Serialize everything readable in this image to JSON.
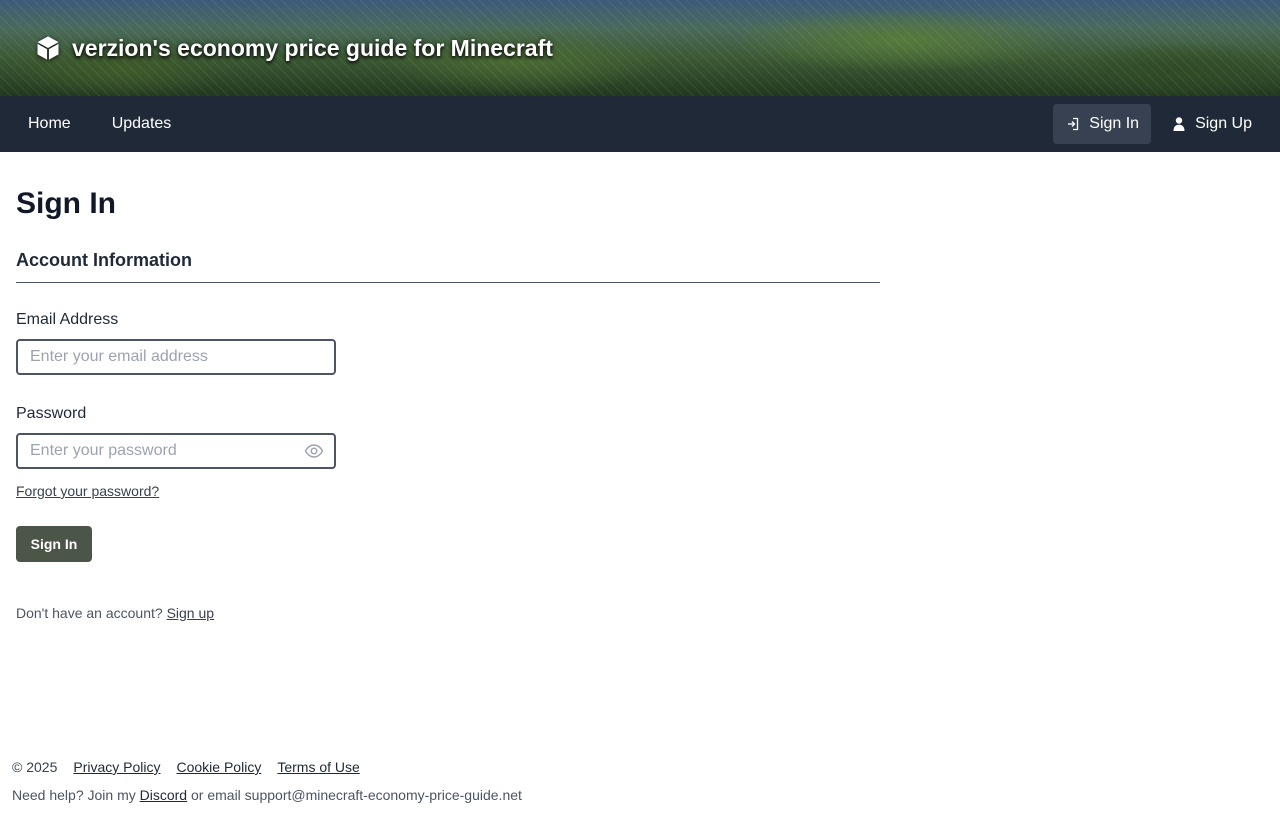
{
  "banner": {
    "title": "verzion's economy price guide for Minecraft",
    "logo_icon": "cube-icon"
  },
  "nav": {
    "left": [
      {
        "label": "Home"
      },
      {
        "label": "Updates"
      }
    ],
    "sign_in": {
      "label": "Sign In",
      "icon": "login-icon",
      "active": true
    },
    "sign_up": {
      "label": "Sign Up",
      "icon": "user-icon"
    }
  },
  "main": {
    "title": "Sign In",
    "section_title": "Account Information",
    "email": {
      "label": "Email Address",
      "placeholder": "Enter your email address",
      "value": ""
    },
    "password": {
      "label": "Password",
      "placeholder": "Enter your password",
      "value": "",
      "toggle_icon": "eye-icon"
    },
    "forgot_link": "Forgot your password?",
    "submit_label": "Sign In",
    "signup_prompt": "Don't have an account?",
    "signup_link": "Sign up"
  },
  "footer": {
    "copyright": "© 2025",
    "links": [
      "Privacy Policy",
      "Cookie Policy",
      "Terms of Use"
    ],
    "help_prefix": "Need help? Join my",
    "discord_link": "Discord",
    "help_suffix": "or email support@minecraft-economy-price-guide.net"
  },
  "colors": {
    "nav_bg": "#1f2937",
    "nav_active_bg": "#374151",
    "button_bg": "#4b5548",
    "text": "#1f2937"
  }
}
